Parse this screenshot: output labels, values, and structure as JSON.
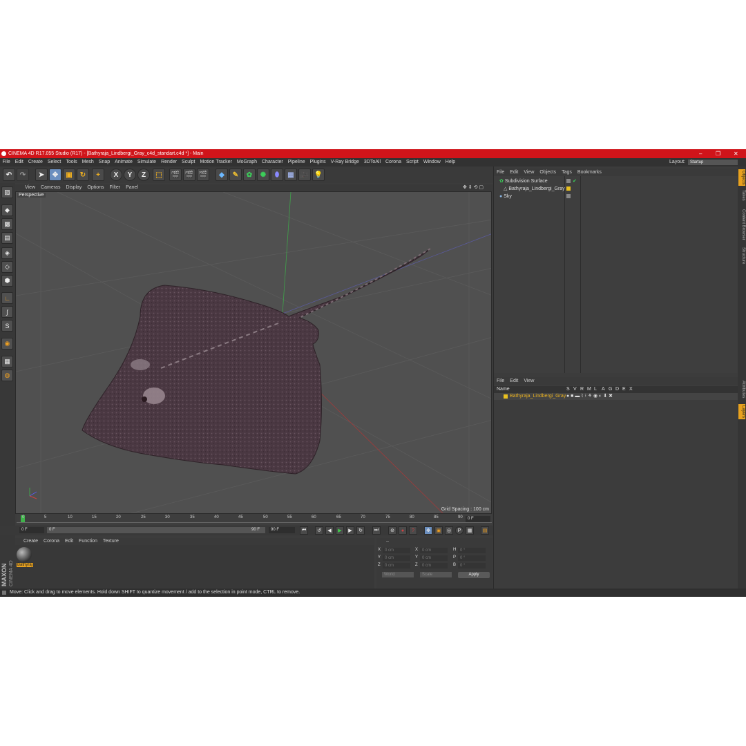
{
  "window": {
    "title": "CINEMA 4D R17.055 Studio (R17) - [Bathyraja_Lindbergi_Gray_c4d_standart.c4d *] - Main",
    "controls": [
      "–",
      "❐",
      "✕"
    ]
  },
  "menubar": {
    "items": [
      "File",
      "Edit",
      "Create",
      "Select",
      "Tools",
      "Mesh",
      "Snap",
      "Animate",
      "Simulate",
      "Render",
      "Sculpt",
      "Motion Tracker",
      "MoGraph",
      "Character",
      "Pipeline",
      "Plugins",
      "V-Ray Bridge",
      "3DToAll",
      "Corona",
      "Script",
      "Window",
      "Help"
    ],
    "layout_label": "Layout:",
    "layout_value": "Startup"
  },
  "toolbar": {
    "axis_x": "X",
    "axis_y": "Y",
    "axis_z": "Z"
  },
  "viewport": {
    "menu": [
      "View",
      "Cameras",
      "Display",
      "Options",
      "Filter",
      "Panel"
    ],
    "label": "Perspective",
    "grid_spacing": "Grid Spacing : 100 cm"
  },
  "timeline": {
    "ticks": [
      "0",
      "5",
      "10",
      "15",
      "20",
      "25",
      "30",
      "35",
      "40",
      "45",
      "50",
      "55",
      "60",
      "65",
      "70",
      "75",
      "80",
      "85",
      "90"
    ],
    "end_field": "0 F"
  },
  "playback": {
    "current_frame": "0 F",
    "start_field": "0 F",
    "range_end": "90 F",
    "end_frame": "90 F"
  },
  "material_manager": {
    "menu": [
      "Create",
      "Corona",
      "Edit",
      "Function",
      "Texture"
    ],
    "material_name": "Bathyraj"
  },
  "coordinates": {
    "header_dashes": "--",
    "rows": [
      {
        "a": "X",
        "av": "0 cm",
        "b": "X",
        "bv": "0 cm",
        "c": "H",
        "cv": "0 °"
      },
      {
        "a": "Y",
        "av": "0 cm",
        "b": "Y",
        "bv": "0 cm",
        "c": "P",
        "cv": "0 °"
      },
      {
        "a": "Z",
        "av": "0 cm",
        "b": "Z",
        "bv": "0 cm",
        "c": "B",
        "cv": "0 °"
      }
    ],
    "mode_world": "World",
    "mode_scale": "Scale",
    "apply": "Apply"
  },
  "object_manager": {
    "menu": [
      "File",
      "Edit",
      "View",
      "Objects",
      "Tags",
      "Bookmarks"
    ],
    "objects": [
      "Subdivision Surface",
      "Bathyraja_Lindbergi_Gray",
      "Sky"
    ]
  },
  "layer_manager": {
    "menu": [
      "File",
      "Edit",
      "View"
    ],
    "header_name": "Name",
    "header_cols": [
      "S",
      "V",
      "R",
      "M",
      "L",
      "A",
      "G",
      "D",
      "E",
      "X"
    ],
    "layer_name": "Bathyraja_Lindbergi_Gray"
  },
  "right_tabs": [
    "Objects",
    "Takes",
    "Content Browser",
    "Structure",
    "Attributes",
    "Layers"
  ],
  "status": "Move: Click and drag to move elements. Hold down SHIFT to quantize movement / add to the selection in point mode, CTRL to remove.",
  "branding": {
    "maxon": "MAXON",
    "c4d": "CINEMA 4D"
  },
  "colors": {
    "title_red": "#d0141a",
    "accent_blue": "#6b8fbf",
    "layer_yellow": "#e8c020",
    "stingray": "#4e3a44"
  }
}
